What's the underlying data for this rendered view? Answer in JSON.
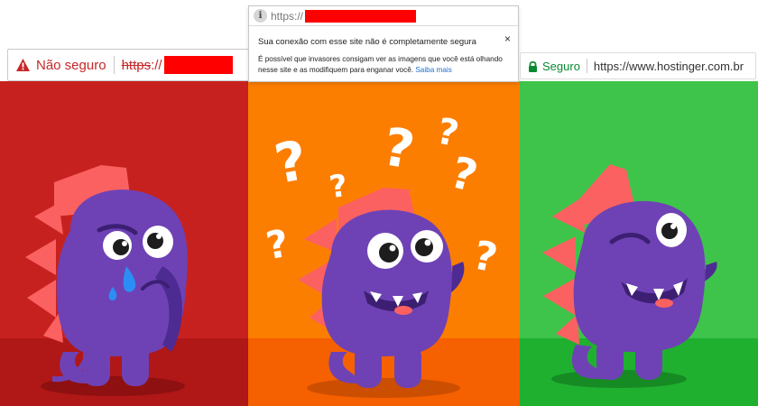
{
  "insecure_bar": {
    "label": "Não seguro",
    "scheme": "https",
    "slashes": "://"
  },
  "popup": {
    "url_prefix": "https://",
    "title": "Sua conexão com esse site não é completamente segura",
    "body": "É possível que invasores consigam ver as imagens que você está olhando nesse site e as modifiquem para enganar você.",
    "link": "Saiba mais",
    "close": "×"
  },
  "secure_bar": {
    "label": "Seguro",
    "url": "https://www.hostinger.com.br"
  },
  "colors": {
    "insecure": "#c62828",
    "secure": "#0a8a2f",
    "link": "#1a6fd1",
    "panel_red": "#c7211f",
    "panel_orange": "#fc7e00",
    "panel_green": "#3ec44a",
    "monster": "#6e42b4",
    "spikes": "#fb6161",
    "redaction": "#ff0000"
  },
  "icons": [
    "warning-triangle-icon",
    "lock-icon",
    "info-icon",
    "close-icon"
  ],
  "illustration": {
    "panels": [
      "sad-monster",
      "confused-monster",
      "happy-monster"
    ],
    "question_marks": [
      "?",
      "?",
      "?",
      "?",
      "?",
      "?",
      "?"
    ]
  }
}
